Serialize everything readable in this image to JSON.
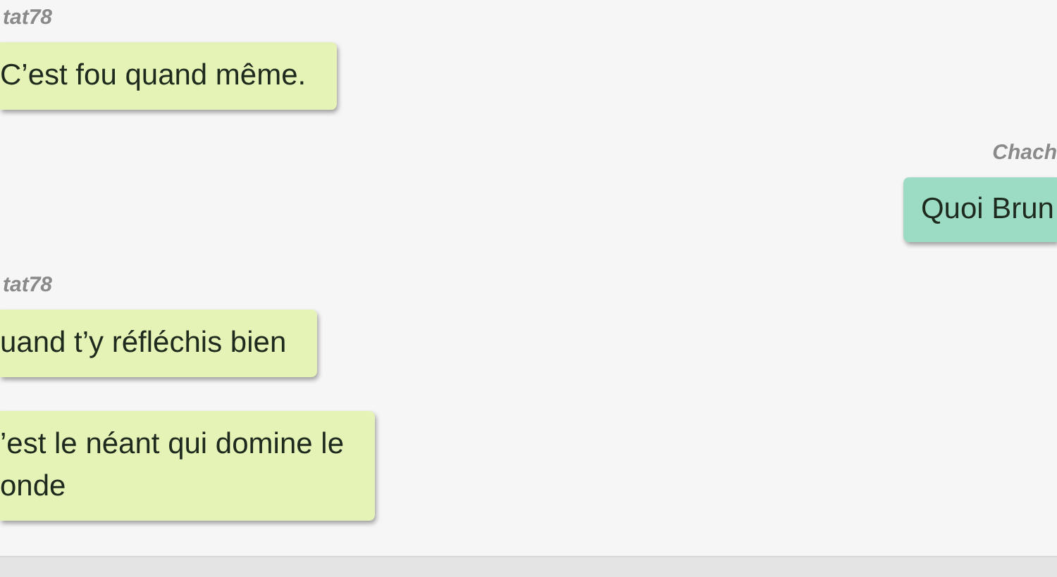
{
  "messages": [
    {
      "kind": "incoming",
      "sender": "tat78",
      "bubbles": [
        "C’est fou quand même."
      ]
    },
    {
      "kind": "outgoing",
      "sender": "Chach",
      "bubbles": [
        "Quoi Brun"
      ]
    },
    {
      "kind": "incoming",
      "sender": "tat78",
      "bubbles": [
        "uand t’y réfléchis bien",
        "’est le néant qui domine le\nonde"
      ]
    }
  ]
}
